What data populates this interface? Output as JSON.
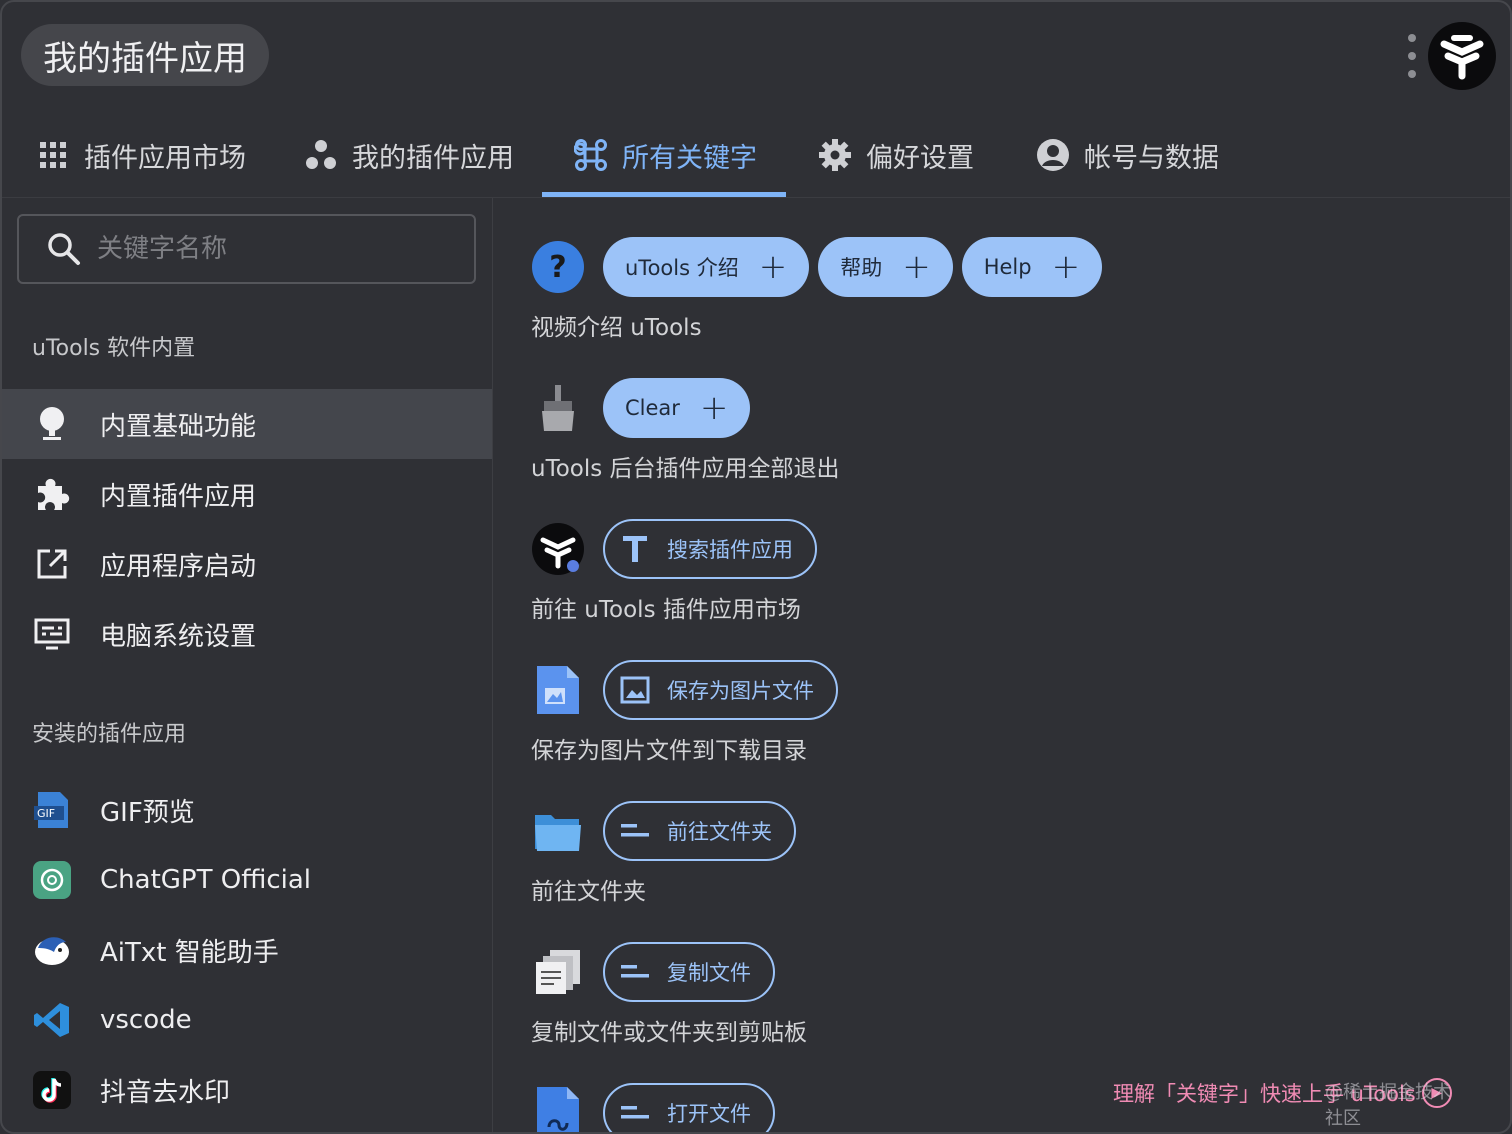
{
  "header": {
    "title": "我的插件应用"
  },
  "tabs": [
    {
      "label": "插件应用市场",
      "icon": "grid-icon"
    },
    {
      "label": "我的插件应用",
      "icon": "dots-cluster-icon"
    },
    {
      "label": "所有关键字",
      "icon": "command-icon"
    },
    {
      "label": "偏好设置",
      "icon": "gear-icon"
    },
    {
      "label": "帐号与数据",
      "icon": "account-circle-icon"
    }
  ],
  "colors": {
    "accent": "#7fb4f7",
    "chip_fill": "#9cc3f8",
    "link_pink": "#f08bb4",
    "background": "#2f3035"
  },
  "sidebar": {
    "search_placeholder": "关键字名称",
    "section_builtin": "uTools 软件内置",
    "builtin_items": [
      {
        "label": "内置基础功能",
        "icon": "bulb-icon"
      },
      {
        "label": "内置插件应用",
        "icon": "puzzle-icon"
      },
      {
        "label": "应用程序启动",
        "icon": "open-external-icon"
      },
      {
        "label": "电脑系统设置",
        "icon": "monitor-settings-icon"
      }
    ],
    "section_installed": "安装的插件应用",
    "installed_items": [
      {
        "label": "GIF预览",
        "icon": "gif-icon"
      },
      {
        "label": "ChatGPT Official",
        "icon": "chatgpt-icon"
      },
      {
        "label": "AiTxt 智能助手",
        "icon": "aitxt-icon"
      },
      {
        "label": "vscode",
        "icon": "vscode-icon"
      },
      {
        "label": "抖音去水印",
        "icon": "tiktok-icon"
      }
    ]
  },
  "keywords": [
    {
      "icon": "help-icon",
      "chips": [
        "uTools 介绍",
        "帮助",
        "Help"
      ],
      "desc": "视频介绍 uTools"
    },
    {
      "icon": "broom-icon",
      "chips": [
        "Clear"
      ],
      "desc": "uTools 后台插件应用全部退出"
    },
    {
      "icon": "utools-logo-icon",
      "chip": "搜索插件应用",
      "chip_icon": "text-t-icon",
      "desc": "前往 uTools 插件应用市场"
    },
    {
      "icon": "image-file-icon",
      "chip": "保存为图片文件",
      "chip_icon": "image-icon",
      "desc": "保存为图片文件到下载目录"
    },
    {
      "icon": "folder-icon",
      "chip": "前往文件夹",
      "chip_icon": "lines-icon",
      "desc": "前往文件夹"
    },
    {
      "icon": "copy-files-icon",
      "chip": "复制文件",
      "chip_icon": "lines-icon",
      "desc": "复制文件或文件夹到剪贴板"
    },
    {
      "icon": "open-file-icon",
      "chip": "打开文件",
      "chip_icon": "lines-icon"
    }
  ],
  "footer": {
    "link": "理解「关键字」快速上手 uTools",
    "watermark": "@稀土掘金技术社区"
  }
}
